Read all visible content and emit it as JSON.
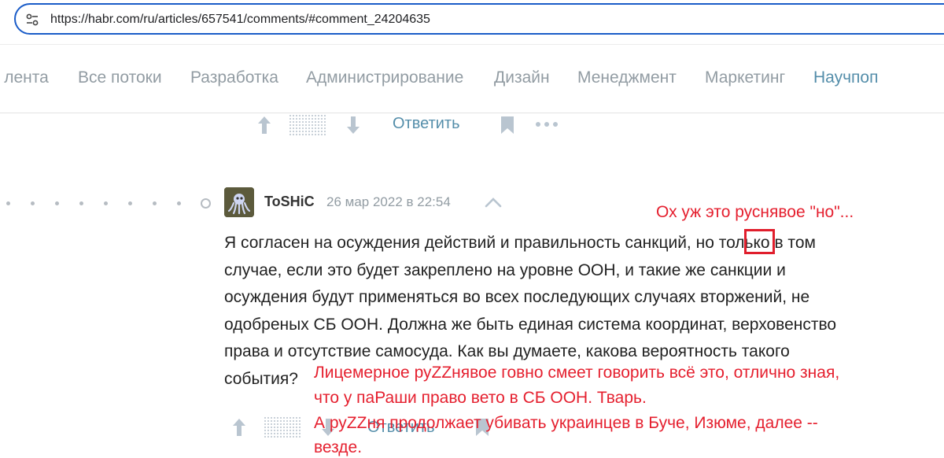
{
  "browser": {
    "url": "https://habr.com/ru/articles/657541/comments/#comment_24204635"
  },
  "nav": {
    "items": [
      {
        "label": "я лента",
        "active": false
      },
      {
        "label": "Все потоки",
        "active": false
      },
      {
        "label": "Разработка",
        "active": false
      },
      {
        "label": "Администрирование",
        "active": false
      },
      {
        "label": "Дизайн",
        "active": false
      },
      {
        "label": "Менеджмент",
        "active": false
      },
      {
        "label": "Маркетинг",
        "active": false
      },
      {
        "label": "Научпоп",
        "active": true
      }
    ]
  },
  "actions": {
    "reply_label": "Ответить"
  },
  "comment": {
    "author": "ToSHiC",
    "timestamp": "26 мар 2022 в 22:54",
    "lines": [
      "Я согласен на осуждения действий и правильность санкций, но только в том",
      "случае, если это будет закреплено на уровне ООН, и такие же санкции и",
      "осуждения будут применяться во всех последующих случаях вторжений, не",
      "одобреных СБ ООН. Должна же быть единая система координат, верховенство",
      "права и отсутствие самосуда. Как вы думаете, какова вероятность такого",
      "события?"
    ]
  },
  "annotations": {
    "top_note": "Ох уж это руснявое \"но\"...",
    "bottom_lines": [
      "Лицемерное руZZнявое говно смеет говорить всё это, отлично зная,",
      "что у паРаши право вето в СБ ООН. Тварь.",
      "А руZZня продолжает убивать украинцев в Буче, Изюме, далее --",
      "везде."
    ]
  },
  "colors": {
    "link": "#548eaa",
    "annotation": "#e5202f",
    "url_border": "#1a5cc8"
  }
}
